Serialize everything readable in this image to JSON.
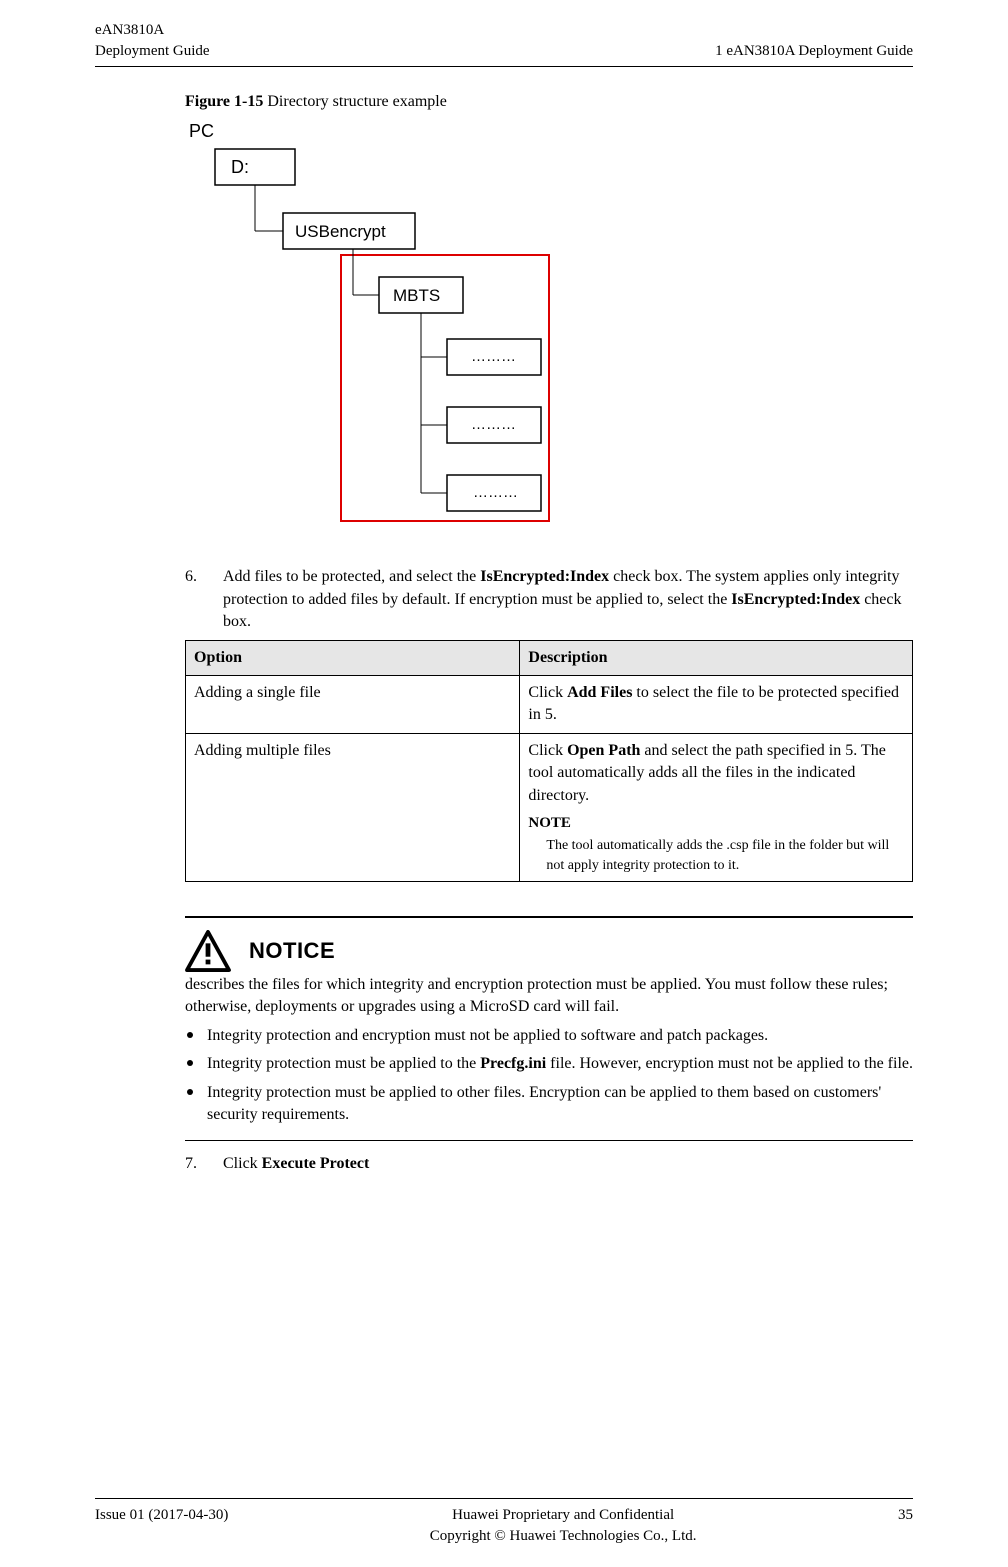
{
  "header": {
    "product": "eAN3810A",
    "doc_left": "Deployment Guide",
    "doc_right": "1 eAN3810A Deployment Guide"
  },
  "figure": {
    "label": "Figure 1-15",
    "caption": " Directory structure example",
    "diagram": {
      "root": "PC",
      "drive": "D:",
      "folder1": "USBencrypt",
      "folder2": "MBTS",
      "dots1": "………",
      "dots2": "………",
      "dots3": "……..."
    }
  },
  "step6": {
    "number": "6.",
    "text_pre": "Add files to be protected, and select the ",
    "bold1": "IsEncrypted:Index",
    "text_mid": " check box. The system applies only integrity protection to added files by default. If encryption must be applied to, select the ",
    "bold2": "IsEncrypted:Index",
    "text_post": " check box."
  },
  "table": {
    "head_option": "Option",
    "head_description": "Description",
    "rows": [
      {
        "option": "Adding a single file",
        "desc_pre": "Click ",
        "desc_bold": "Add Files",
        "desc_post": " to select the file to be protected specified in 5."
      },
      {
        "option": "Adding multiple files",
        "desc_pre": "Click ",
        "desc_bold": "Open Path",
        "desc_post": " and select the path specified in 5. The tool automatically adds all the files in the indicated directory.",
        "note_label": "NOTE",
        "note_text": "The tool automatically adds the .csp file in the folder but will not apply integrity protection to it."
      }
    ]
  },
  "notice": {
    "title": "NOTICE",
    "intro": "describes the files for which integrity and encryption protection must be applied. You must follow these rules; otherwise, deployments or upgrades using a MicroSD card will fail.",
    "items": [
      {
        "pre": "Integrity protection and encryption must not be applied to software and patch packages.",
        "bold": "",
        "post": ""
      },
      {
        "pre": "Integrity protection must be applied to the ",
        "bold": "Precfg.ini",
        "post": " file. However, encryption must not be applied to the file."
      },
      {
        "pre": "Integrity protection must be applied to other files. Encryption can be applied to them based on customers' security requirements.",
        "bold": "",
        "post": ""
      }
    ]
  },
  "step7": {
    "number": "7.",
    "text_pre": "Click ",
    "bold": "Execute Protect"
  },
  "footer": {
    "issue": "Issue 01 (2017-04-30)",
    "line1": "Huawei Proprietary and Confidential",
    "line2": "Copyright © Huawei Technologies Co., Ltd.",
    "page": "35"
  }
}
